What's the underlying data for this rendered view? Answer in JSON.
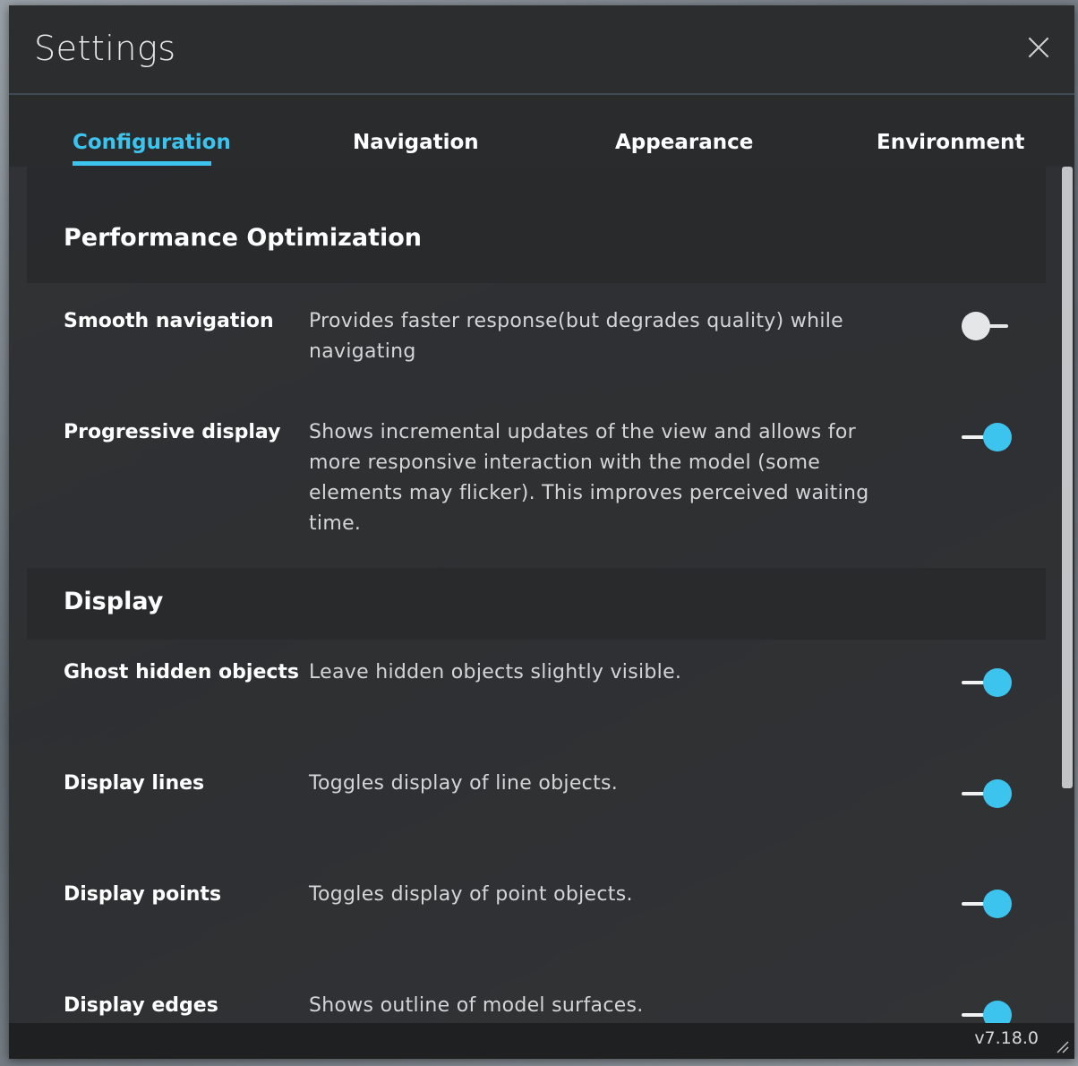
{
  "panel": {
    "title": "Settings",
    "close_icon": "close-icon"
  },
  "tabs": [
    {
      "label": "Configuration",
      "active": true
    },
    {
      "label": "Navigation",
      "active": false
    },
    {
      "label": "Appearance",
      "active": false
    },
    {
      "label": "Environment",
      "active": false
    }
  ],
  "sections": {
    "performance": {
      "title": "Performance Optimization",
      "rows": [
        {
          "label": "Smooth navigation",
          "description": "Provides faster response(but degrades quality) while navigating",
          "enabled": false
        },
        {
          "label": "Progressive display",
          "description": "Shows incremental updates of the view and allows for more responsive interaction with the model (some elements may flicker). This improves perceived waiting time.",
          "enabled": true
        }
      ]
    },
    "display": {
      "title": "Display",
      "rows": [
        {
          "label": "Ghost hidden objects",
          "description": "Leave hidden objects slightly visible.",
          "enabled": true
        },
        {
          "label": "Display lines",
          "description": "Toggles display of line objects.",
          "enabled": true
        },
        {
          "label": "Display points",
          "description": "Toggles display of point objects.",
          "enabled": true
        },
        {
          "label": "Display edges",
          "description": "Shows outline of model surfaces.",
          "enabled": true
        }
      ]
    }
  },
  "footer": {
    "version": "v7.18.0"
  },
  "colors": {
    "accent": "#3dc4ee",
    "panel_bg": "#2a2b2d"
  }
}
